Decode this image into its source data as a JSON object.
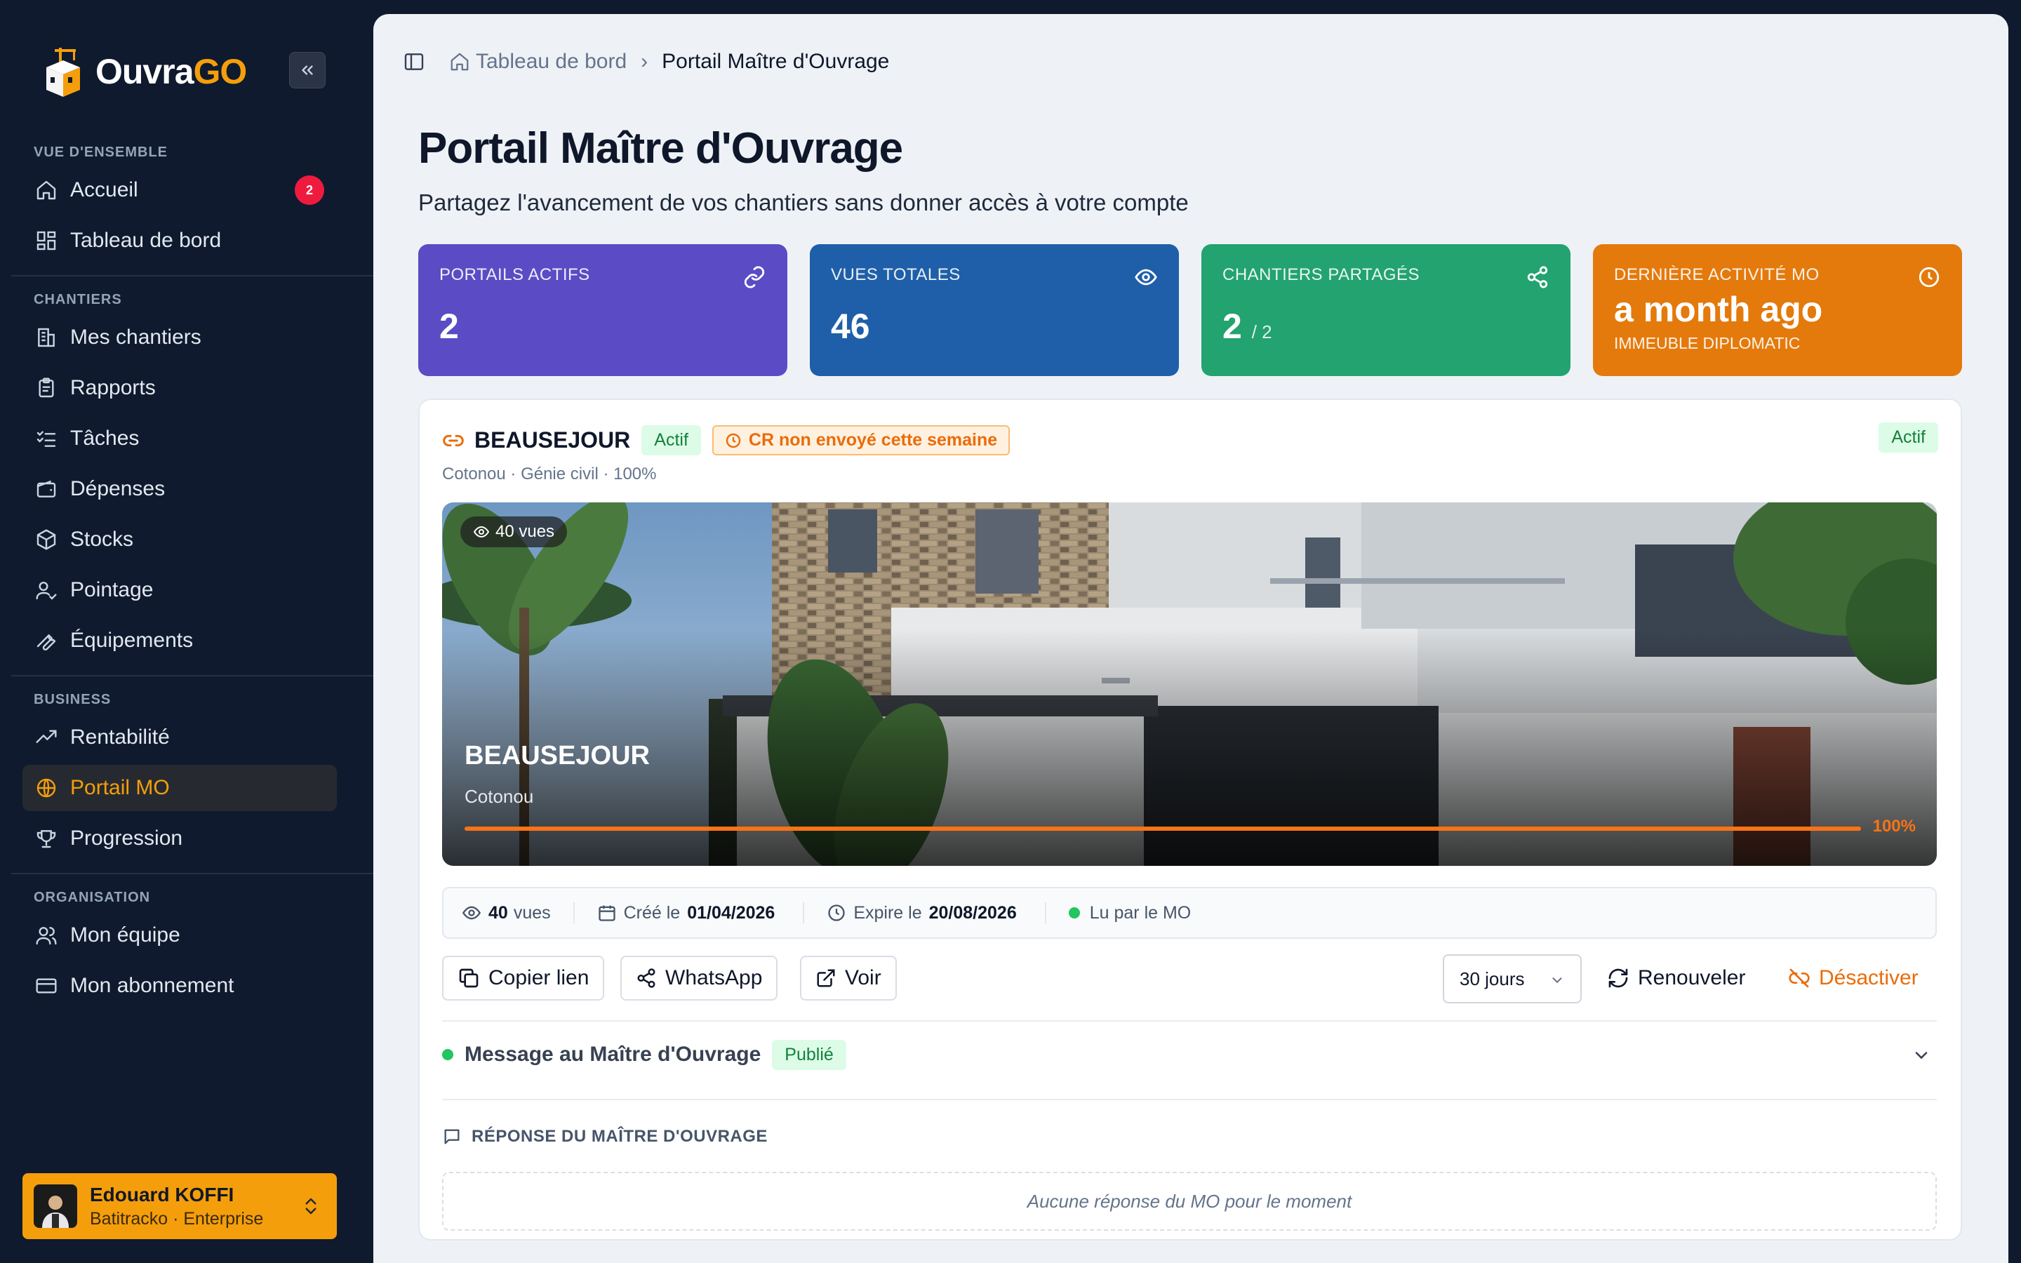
{
  "brand": {
    "name": "Ouvra",
    "accent": "GO"
  },
  "nav": {
    "sections": [
      {
        "title": "VUE D'ENSEMBLE",
        "items": [
          {
            "label": "Accueil",
            "icon": "home-icon",
            "badge": "2"
          },
          {
            "label": "Tableau de bord",
            "icon": "dashboard-icon"
          }
        ]
      },
      {
        "title": "CHANTIERS",
        "items": [
          {
            "label": "Mes chantiers",
            "icon": "building-icon"
          },
          {
            "label": "Rapports",
            "icon": "clipboard-icon"
          },
          {
            "label": "Tâches",
            "icon": "checklist-icon"
          },
          {
            "label": "Dépenses",
            "icon": "wallet-icon"
          },
          {
            "label": "Stocks",
            "icon": "box-icon"
          },
          {
            "label": "Pointage",
            "icon": "user-check-icon"
          },
          {
            "label": "Équipements",
            "icon": "wrench-icon"
          }
        ]
      },
      {
        "title": "BUSINESS",
        "items": [
          {
            "label": "Rentabilité",
            "icon": "trending-up-icon"
          },
          {
            "label": "Portail MO",
            "icon": "globe-icon",
            "active": true
          },
          {
            "label": "Progression",
            "icon": "trophy-icon"
          }
        ]
      },
      {
        "title": "ORGANISATION",
        "items": [
          {
            "label": "Mon équipe",
            "icon": "users-icon"
          },
          {
            "label": "Mon abonnement",
            "icon": "credit-card-icon"
          }
        ]
      }
    ]
  },
  "user": {
    "name": "Edouard KOFFI",
    "subtitle": "Batitracko · Enterprise"
  },
  "breadcrumb": {
    "home": "Tableau de bord",
    "current": "Portail Maître d'Ouvrage"
  },
  "page": {
    "title": "Portail Maître d'Ouvrage",
    "subtitle": "Partagez l'avancement de vos chantiers sans donner accès à votre compte"
  },
  "stats": {
    "portals": {
      "label": "PORTAILS ACTIFS",
      "value": "2",
      "color": "#5b4bc4"
    },
    "views": {
      "label": "VUES TOTALES",
      "value": "46",
      "color": "#1f5fa9"
    },
    "shared": {
      "label": "CHANTIERS PARTAGÉS",
      "value": "2",
      "total": "/ 2",
      "color": "#22a36f"
    },
    "activity": {
      "label": "DERNIÈRE ACTIVITÉ MO",
      "value": "a month ago",
      "footer": "IMMEUBLE DIPLOMATIC",
      "color": "#e47a0c"
    }
  },
  "portal": {
    "name": "BEAUSEJOUR",
    "status": "Actif",
    "warning": "CR non envoyé cette semaine",
    "status_right": "Actif",
    "subtitle": "Cotonou · Génie civil · 100%",
    "hero": {
      "views_badge": "40 vues",
      "title": "BEAUSEJOUR",
      "city": "Cotonou",
      "progress_pct": 100,
      "progress_label": "100%"
    },
    "meta": {
      "views_value": "40",
      "views_label": "vues",
      "created_label": "Créé le",
      "created_value": "01/04/2026",
      "expires_label": "Expire le",
      "expires_value": "20/08/2026",
      "read_label": "Lu par le MO"
    },
    "actions": {
      "copy": "Copier lien",
      "whatsapp": "WhatsApp",
      "view": "Voir",
      "duration": "30 jours",
      "renew": "Renouveler",
      "deactivate": "Désactiver"
    },
    "message": {
      "title": "Message au Maître d'Ouvrage",
      "status": "Publié"
    },
    "response": {
      "label": "RÉPONSE DU MAÎTRE D'OUVRAGE",
      "empty": "Aucune réponse du MO pour le moment"
    }
  }
}
